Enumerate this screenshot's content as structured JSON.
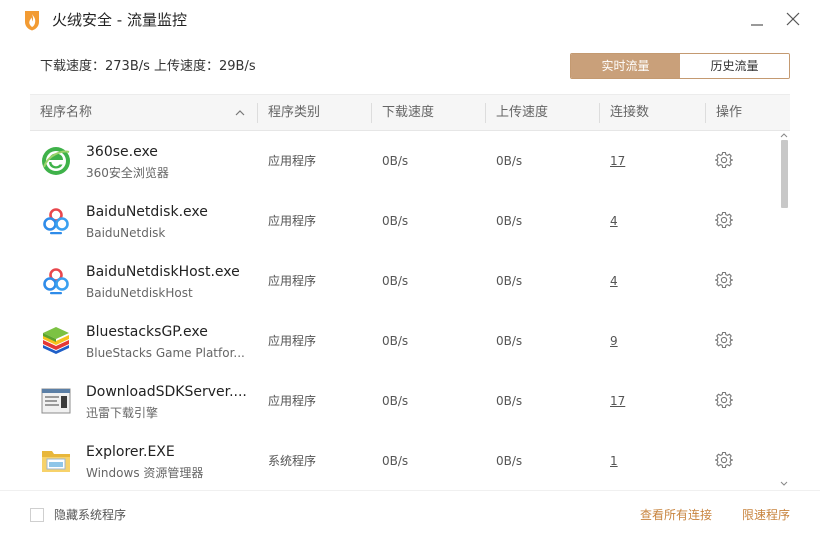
{
  "window": {
    "title": "火绒安全 - 流量监控"
  },
  "speed": {
    "text": "下载速度：273B/s  上传速度：29B/s"
  },
  "tabs": [
    {
      "label": "实时流量",
      "active": true
    },
    {
      "label": "历史流量",
      "active": false
    }
  ],
  "table": {
    "headers": {
      "name": "程序名称",
      "type": "程序类别",
      "download": "下载速度",
      "upload": "上传速度",
      "connections": "连接数",
      "action": "操作"
    },
    "rows": [
      {
        "icon": "360-browser-icon",
        "name": "360se.exe",
        "desc": "360安全浏览器",
        "type": "应用程序",
        "download": "0B/s",
        "upload": "0B/s",
        "connections": "17"
      },
      {
        "icon": "baidu-netdisk-icon",
        "name": "BaiduNetdisk.exe",
        "desc": "BaiduNetdisk",
        "type": "应用程序",
        "download": "0B/s",
        "upload": "0B/s",
        "connections": "4"
      },
      {
        "icon": "baidu-netdisk-icon",
        "name": "BaiduNetdiskHost.exe",
        "desc": "BaiduNetdiskHost",
        "type": "应用程序",
        "download": "0B/s",
        "upload": "0B/s",
        "connections": "4"
      },
      {
        "icon": "bluestacks-icon",
        "name": "BluestacksGP.exe",
        "desc": "BlueStacks Game Platfor...",
        "type": "应用程序",
        "download": "0B/s",
        "upload": "0B/s",
        "connections": "9"
      },
      {
        "icon": "download-sdk-icon",
        "name": "DownloadSDKServer....",
        "desc": "迅雷下载引擎",
        "type": "应用程序",
        "download": "0B/s",
        "upload": "0B/s",
        "connections": "17"
      },
      {
        "icon": "explorer-folder-icon",
        "name": "Explorer.EXE",
        "desc": "Windows 资源管理器",
        "type": "系统程序",
        "download": "0B/s",
        "upload": "0B/s",
        "connections": "1"
      }
    ]
  },
  "footer": {
    "hide_system_label": "隐藏系统程序",
    "view_all_connections": "查看所有连接",
    "limit_speed": "限速程序"
  },
  "colors": {
    "accent": "#c9a07a",
    "link": "#c8843e"
  }
}
